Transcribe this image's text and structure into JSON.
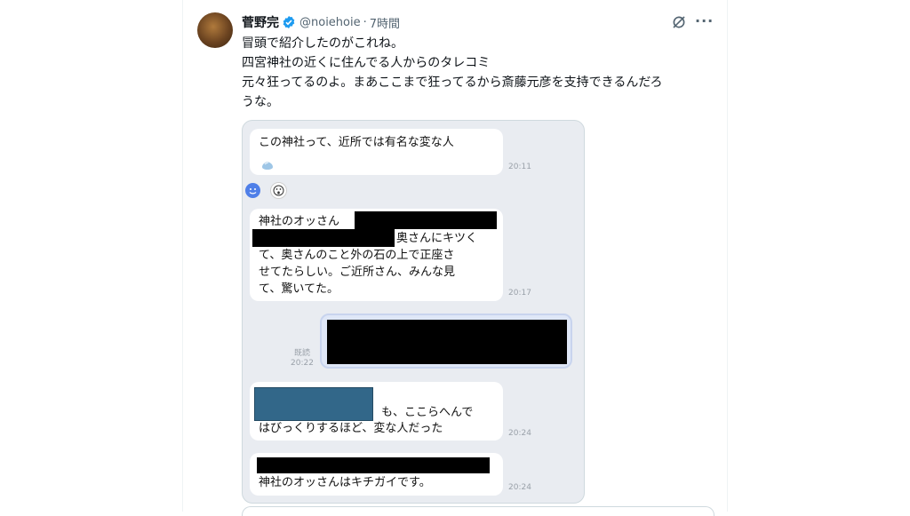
{
  "author": {
    "name": "菅野完",
    "handle": "@noiehoie",
    "separator": "·",
    "time": "7時間"
  },
  "tweet": {
    "lines": [
      "冒頭で紹介したのがこれね。",
      "四宮神社の近くに住んでる人からのタレコミ",
      "元々狂ってるのよ。まあここまで狂ってるから斎藤元彦を支持できるんだろ",
      "うな。"
    ]
  },
  "chat": {
    "messages": [
      {
        "text": "この神社って、近所では有名な変な人",
        "time": "20:11"
      },
      {
        "line1": "神社のオッさん",
        "line2": "奥さんにキツく",
        "line3": "て、奥さんのこと外の石の上で正座さ",
        "line4": "せてたらしい。ご近所さん、みんな見",
        "line5": "て、驚いてた。",
        "time": "20:17"
      },
      {
        "read": "既読",
        "time": "20:22"
      },
      {
        "line1": "も、ここらへんで",
        "line2": "はびっくりするほど、変な人だった",
        "time": "20:24"
      },
      {
        "text": "神社のオッさんはキチガイです。",
        "time": "20:24"
      }
    ]
  },
  "colors": {
    "verified": "#1d9bf0",
    "chat_bg": "#e9ecf1",
    "redaction": "#000000",
    "blue_redaction": "#326789"
  }
}
